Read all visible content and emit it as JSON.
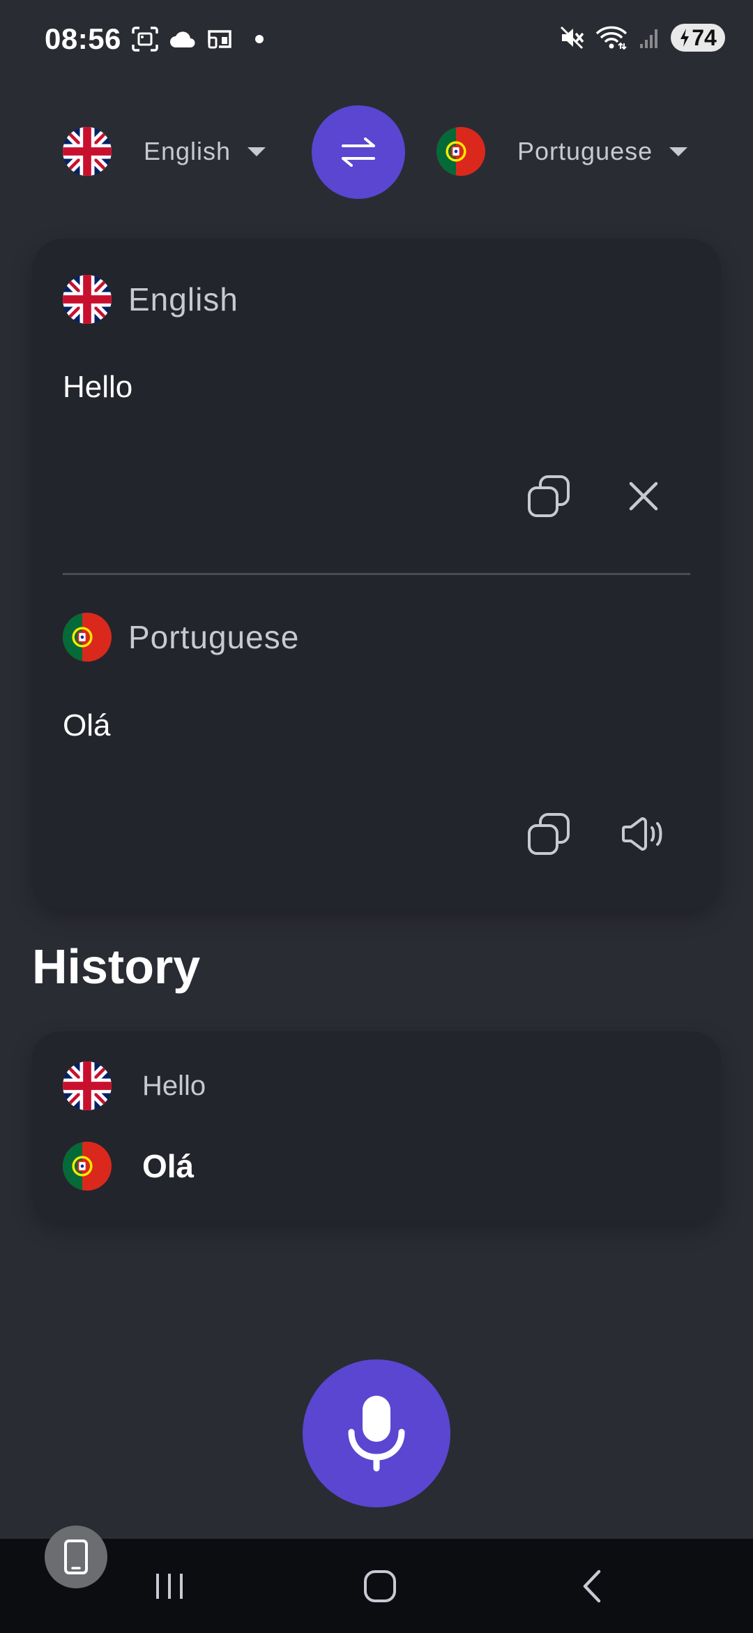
{
  "status_bar": {
    "time": "08:56",
    "battery": "74",
    "icons": [
      "screenshot-icon",
      "cloud-icon",
      "cast-icon",
      "dot-icon",
      "mute-icon",
      "wifi-icon",
      "signal-icon",
      "battery-icon"
    ]
  },
  "language_bar": {
    "source_language": "English",
    "target_language": "Portuguese",
    "swap_icon": "swap-icon"
  },
  "translation_card": {
    "source": {
      "language": "English",
      "text": "Hello"
    },
    "target": {
      "language": "Portuguese",
      "text": "Olá"
    }
  },
  "history": {
    "title": "History",
    "items": [
      {
        "source_text": "Hello",
        "target_text": "Olá"
      }
    ]
  },
  "colors": {
    "background": "#2a2c33",
    "card": "#23252d",
    "accent": "#5a46d1"
  },
  "nav_icons": [
    "recent-apps-icon",
    "home-icon",
    "back-icon"
  ]
}
